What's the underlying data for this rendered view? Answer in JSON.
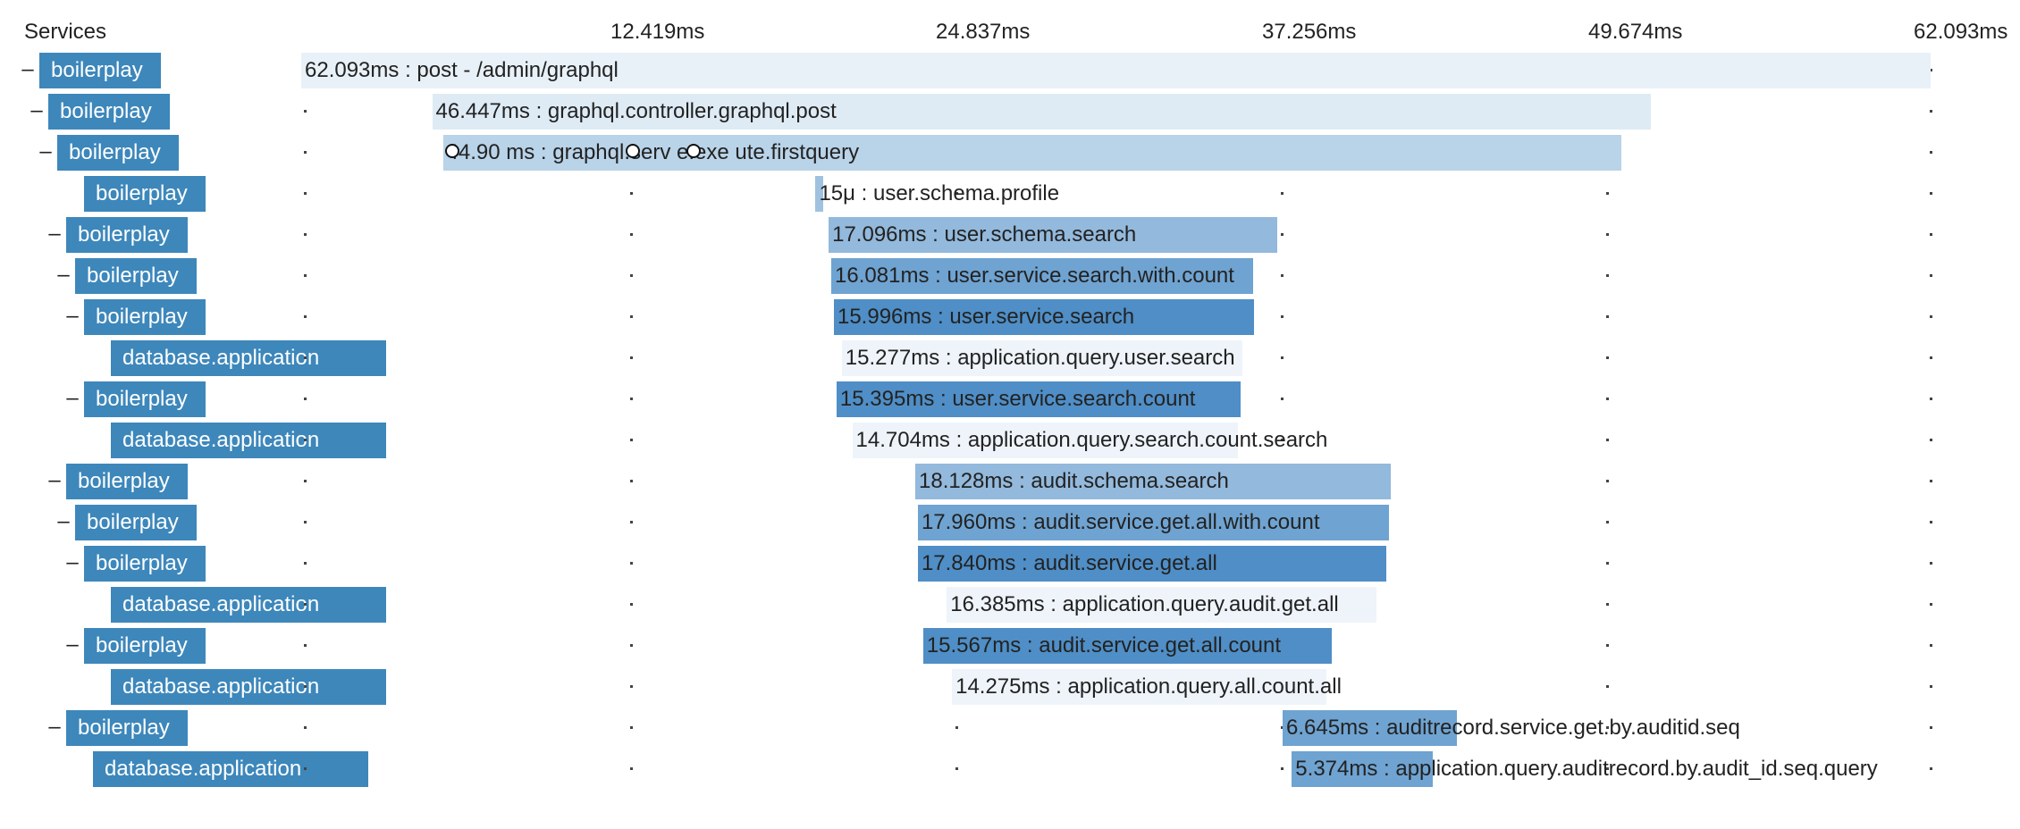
{
  "header": {
    "services_label": "Services",
    "ticks": [
      "12.419ms",
      "24.837ms",
      "37.256ms",
      "49.674ms",
      "62.093ms"
    ]
  },
  "timeline": {
    "start_ms": 0,
    "end_ms": 62.093
  },
  "colors": {
    "service_tag": "#3d87bb"
  },
  "spans": [
    {
      "service": "boilerplay",
      "depth": 0,
      "collapsible": true,
      "start_ms": 0,
      "duration_ms": 62.093,
      "label": "62.093ms : post - /admin/graphql",
      "bar_color": "#e8f1f8"
    },
    {
      "service": "boilerplay",
      "depth": 1,
      "collapsible": true,
      "start_ms": 4.99,
      "duration_ms": 46.447,
      "label": "46.447ms : graphql.controller.graphql.post",
      "bar_color": "#deebf5"
    },
    {
      "service": "boilerplay",
      "depth": 2,
      "collapsible": true,
      "start_ms": 5.4,
      "duration_ms": 44.9,
      "label": "44.90 ms : graphql.serv e.exe ute.firstquery",
      "bar_color": "#b9d3e8"
    },
    {
      "service": "boilerplay",
      "depth": 3,
      "collapsible": false,
      "start_ms": 19.6,
      "duration_ms": 0.3,
      "label": "15μ : user.schema.profile",
      "bar_color": "#9fc2e0"
    },
    {
      "service": "boilerplay",
      "depth": 3,
      "collapsible": true,
      "start_ms": 20.1,
      "duration_ms": 17.096,
      "label": "17.096ms : user.schema.search",
      "bar_color": "#93b9dc"
    },
    {
      "service": "boilerplay",
      "depth": 4,
      "collapsible": true,
      "start_ms": 20.2,
      "duration_ms": 16.081,
      "label": "16.081ms : user.service.search.with.count",
      "bar_color": "#6fa3d1"
    },
    {
      "service": "boilerplay",
      "depth": 5,
      "collapsible": true,
      "start_ms": 20.3,
      "duration_ms": 15.996,
      "label": "15.996ms : user.service.search",
      "bar_color": "#4f8ec6"
    },
    {
      "service": "database.application",
      "depth": 6,
      "collapsible": false,
      "start_ms": 20.6,
      "duration_ms": 15.277,
      "label": "15.277ms : application.query.user.search",
      "bar_color": "#eef4fa"
    },
    {
      "service": "boilerplay",
      "depth": 5,
      "collapsible": true,
      "start_ms": 20.4,
      "duration_ms": 15.395,
      "label": "15.395ms : user.service.search.count",
      "bar_color": "#4f8ec6"
    },
    {
      "service": "database.application",
      "depth": 6,
      "collapsible": false,
      "start_ms": 21.0,
      "duration_ms": 14.704,
      "label": "14.704ms : application.query.search.count.search",
      "bar_color": "#eef4fa"
    },
    {
      "service": "boilerplay",
      "depth": 3,
      "collapsible": true,
      "start_ms": 23.4,
      "duration_ms": 18.128,
      "label": "18.128ms : audit.schema.search",
      "bar_color": "#93b9dc"
    },
    {
      "service": "boilerplay",
      "depth": 4,
      "collapsible": true,
      "start_ms": 23.5,
      "duration_ms": 17.96,
      "label": "17.960ms : audit.service.get.all.with.count",
      "bar_color": "#6fa3d1"
    },
    {
      "service": "boilerplay",
      "depth": 5,
      "collapsible": true,
      "start_ms": 23.5,
      "duration_ms": 17.84,
      "label": "17.840ms : audit.service.get.all",
      "bar_color": "#4f8ec6"
    },
    {
      "service": "database.application",
      "depth": 6,
      "collapsible": false,
      "start_ms": 24.6,
      "duration_ms": 16.385,
      "label": "16.385ms : application.query.audit.get.all",
      "bar_color": "#eef4fa"
    },
    {
      "service": "boilerplay",
      "depth": 5,
      "collapsible": true,
      "start_ms": 23.7,
      "duration_ms": 15.567,
      "label": "15.567ms : audit.service.get.all.count",
      "bar_color": "#4f8ec6"
    },
    {
      "service": "database.application",
      "depth": 6,
      "collapsible": false,
      "start_ms": 24.8,
      "duration_ms": 14.275,
      "label": "14.275ms : application.query.all.count.all",
      "bar_color": "#eef4fa"
    },
    {
      "service": "boilerplay",
      "depth": 3,
      "collapsible": true,
      "start_ms": 37.4,
      "duration_ms": 6.645,
      "label": "6.645ms : auditrecord.service.get.by.auditid.seq",
      "bar_color": "#6fa3d1"
    },
    {
      "service": "database.application",
      "depth": 4,
      "collapsible": false,
      "start_ms": 37.75,
      "duration_ms": 5.374,
      "label": "5.374ms : application.query.auditrecord.by.audit_id.seq.query",
      "bar_color": "#6fa3d1"
    }
  ]
}
